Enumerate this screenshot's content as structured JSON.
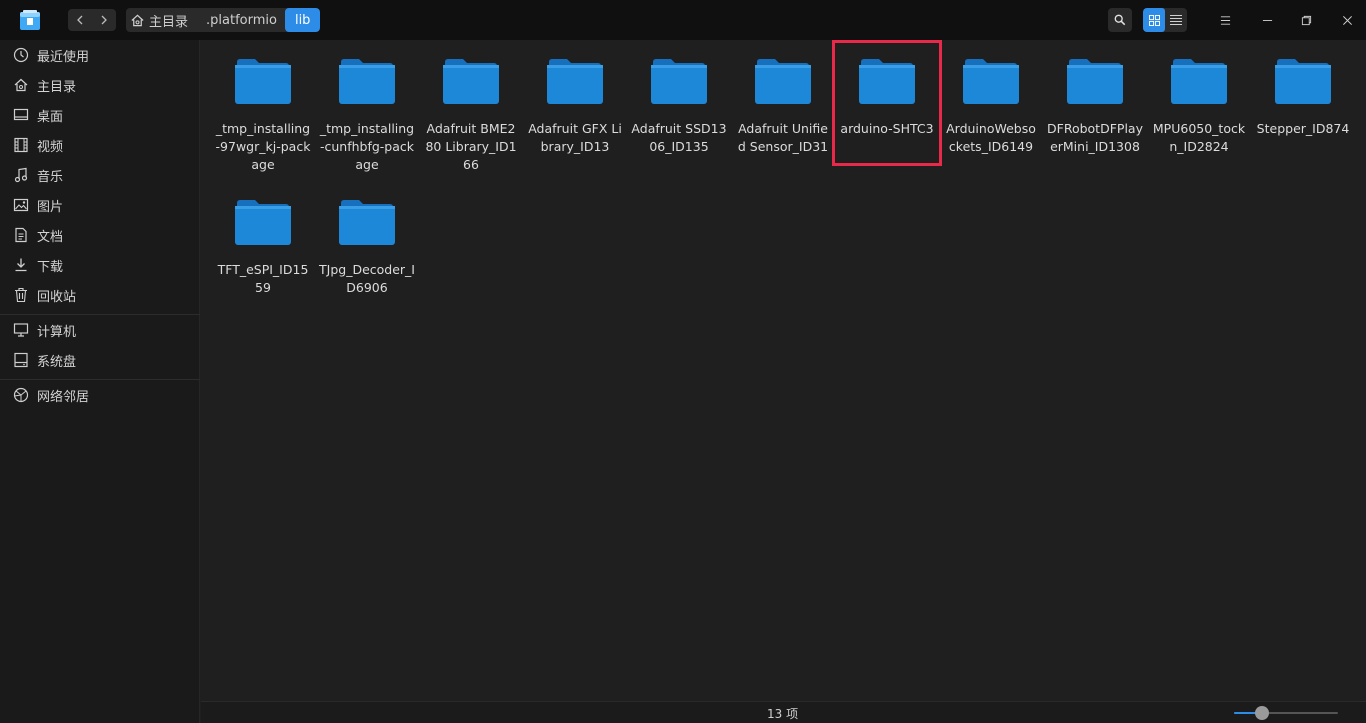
{
  "titlebar": {
    "breadcrumb": [
      "主目录",
      ".platformio",
      "lib"
    ],
    "active_crumb_index": 2
  },
  "sidebar": {
    "groups": [
      [
        {
          "label": "最近使用",
          "icon": "clock-icon"
        },
        {
          "label": "主目录",
          "icon": "home-icon"
        },
        {
          "label": "桌面",
          "icon": "desktop-icon"
        },
        {
          "label": "视频",
          "icon": "video-icon"
        },
        {
          "label": "音乐",
          "icon": "music-icon"
        },
        {
          "label": "图片",
          "icon": "picture-icon"
        },
        {
          "label": "文档",
          "icon": "document-icon"
        },
        {
          "label": "下载",
          "icon": "download-icon"
        },
        {
          "label": "回收站",
          "icon": "trash-icon"
        }
      ],
      [
        {
          "label": "计算机",
          "icon": "computer-icon"
        },
        {
          "label": "系统盘",
          "icon": "disk-icon"
        }
      ],
      [
        {
          "label": "网络邻居",
          "icon": "network-icon"
        }
      ]
    ]
  },
  "files": [
    "_tmp_installing-97wgr_kj-package",
    "_tmp_installing-cunfhbfg-package",
    "Adafruit BME280 Library_ID166",
    "Adafruit GFX Library_ID13",
    "Adafruit SSD1306_ID135",
    "Adafruit Unified Sensor_ID31",
    "arduino-SHTC3",
    "ArduinoWebsockets_ID6149",
    "DFRobotDFPlayerMini_ID1308",
    "MPU6050_tockn_ID2824",
    "Stepper_ID874",
    "TFT_eSPI_ID1559",
    "TJpg_Decoder_ID6906"
  ],
  "highlighted_file": "arduino-SHTC3",
  "statusbar": {
    "count_label": "13 项"
  },
  "colors": {
    "accent": "#2d8ce8",
    "folder": "#1e88d8",
    "highlight": "#e8294a"
  },
  "zoom_level": 0.27
}
